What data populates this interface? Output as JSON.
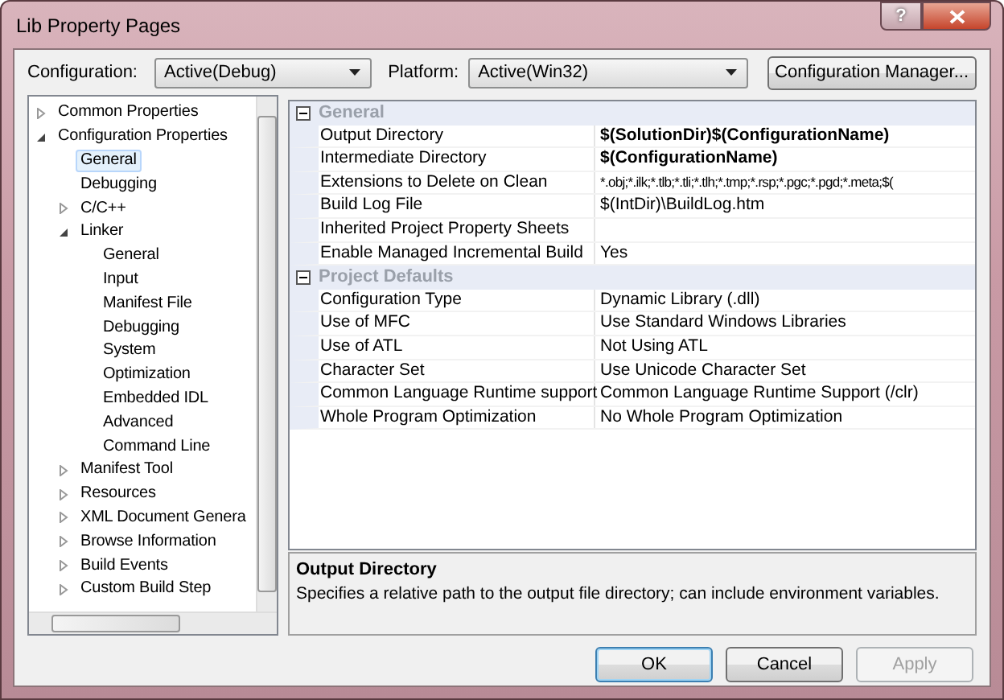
{
  "window": {
    "title": "Lib Property Pages",
    "help_button": "?"
  },
  "configuration": {
    "label": "Configuration:",
    "value": "Active(Debug)"
  },
  "platform": {
    "label": "Platform:",
    "value": "Active(Win32)"
  },
  "configuration_manager_button": "Configuration Manager...",
  "tree": [
    {
      "label": "Common Properties",
      "expanded": false,
      "selected": false
    },
    {
      "label": "Configuration Properties",
      "expanded": true,
      "selected": false,
      "children": [
        {
          "label": "General",
          "selected": true
        },
        {
          "label": "Debugging",
          "selected": false
        },
        {
          "label": "C/C++",
          "expanded": false,
          "selected": false
        },
        {
          "label": "Linker",
          "expanded": true,
          "selected": false,
          "children": [
            {
              "label": "General",
              "selected": false
            },
            {
              "label": "Input",
              "selected": false
            },
            {
              "label": "Manifest File",
              "selected": false
            },
            {
              "label": "Debugging",
              "selected": false
            },
            {
              "label": "System",
              "selected": false
            },
            {
              "label": "Optimization",
              "selected": false
            },
            {
              "label": "Embedded IDL",
              "selected": false
            },
            {
              "label": "Advanced",
              "selected": false
            },
            {
              "label": "Command Line",
              "selected": false
            }
          ]
        },
        {
          "label": "Manifest Tool",
          "expanded": false,
          "selected": false
        },
        {
          "label": "Resources",
          "expanded": false,
          "selected": false
        },
        {
          "label": "XML Document Genera",
          "expanded": false,
          "selected": false
        },
        {
          "label": "Browse Information",
          "expanded": false,
          "selected": false
        },
        {
          "label": "Build Events",
          "expanded": false,
          "selected": false
        },
        {
          "label": "Custom Build Step",
          "expanded": false,
          "selected": false
        }
      ]
    }
  ],
  "property_grid": [
    {
      "category": "General",
      "expanded": true,
      "rows": [
        {
          "name": "Output Directory",
          "value": "$(SolutionDir)$(ConfigurationName)",
          "modified": true
        },
        {
          "name": "Intermediate Directory",
          "value": "$(ConfigurationName)",
          "modified": true
        },
        {
          "name": "Extensions to Delete on Clean",
          "value": "*.obj;*.ilk;*.tlb;*.tli;*.tlh;*.tmp;*.rsp;*.pgc;*.pgd;*.meta;$(",
          "modified": false
        },
        {
          "name": "Build Log File",
          "value": "$(IntDir)\\BuildLog.htm",
          "modified": false
        },
        {
          "name": "Inherited Project Property Sheets"
        },
        {
          "name": "Enable Managed Incremental Build",
          "value": "Yes",
          "modified": false
        }
      ]
    },
    {
      "category": "Project Defaults",
      "expanded": true,
      "rows": [
        {
          "name": "Configuration Type",
          "value": "Dynamic Library (.dll)",
          "modified": false
        },
        {
          "name": "Use of MFC",
          "value": "Use Standard Windows Libraries",
          "modified": false
        },
        {
          "name": "Use of ATL",
          "value": "Not Using ATL",
          "modified": false
        },
        {
          "name": "Character Set",
          "value": "Use Unicode Character Set",
          "modified": false
        },
        {
          "name": "Common Language Runtime support",
          "value": "Common Language Runtime Support (/clr)",
          "modified": false
        },
        {
          "name": "Whole Program Optimization",
          "value": "No Whole Program Optimization",
          "modified": false
        }
      ]
    }
  ],
  "description": {
    "title": "Output Directory",
    "text": "Specifies a relative path to the output file directory; can include environment variables."
  },
  "buttons": [
    {
      "label": "OK",
      "default": true,
      "disabled": false
    },
    {
      "label": "Cancel",
      "default": false,
      "disabled": false
    },
    {
      "label": "Apply",
      "default": false,
      "disabled": true
    }
  ]
}
